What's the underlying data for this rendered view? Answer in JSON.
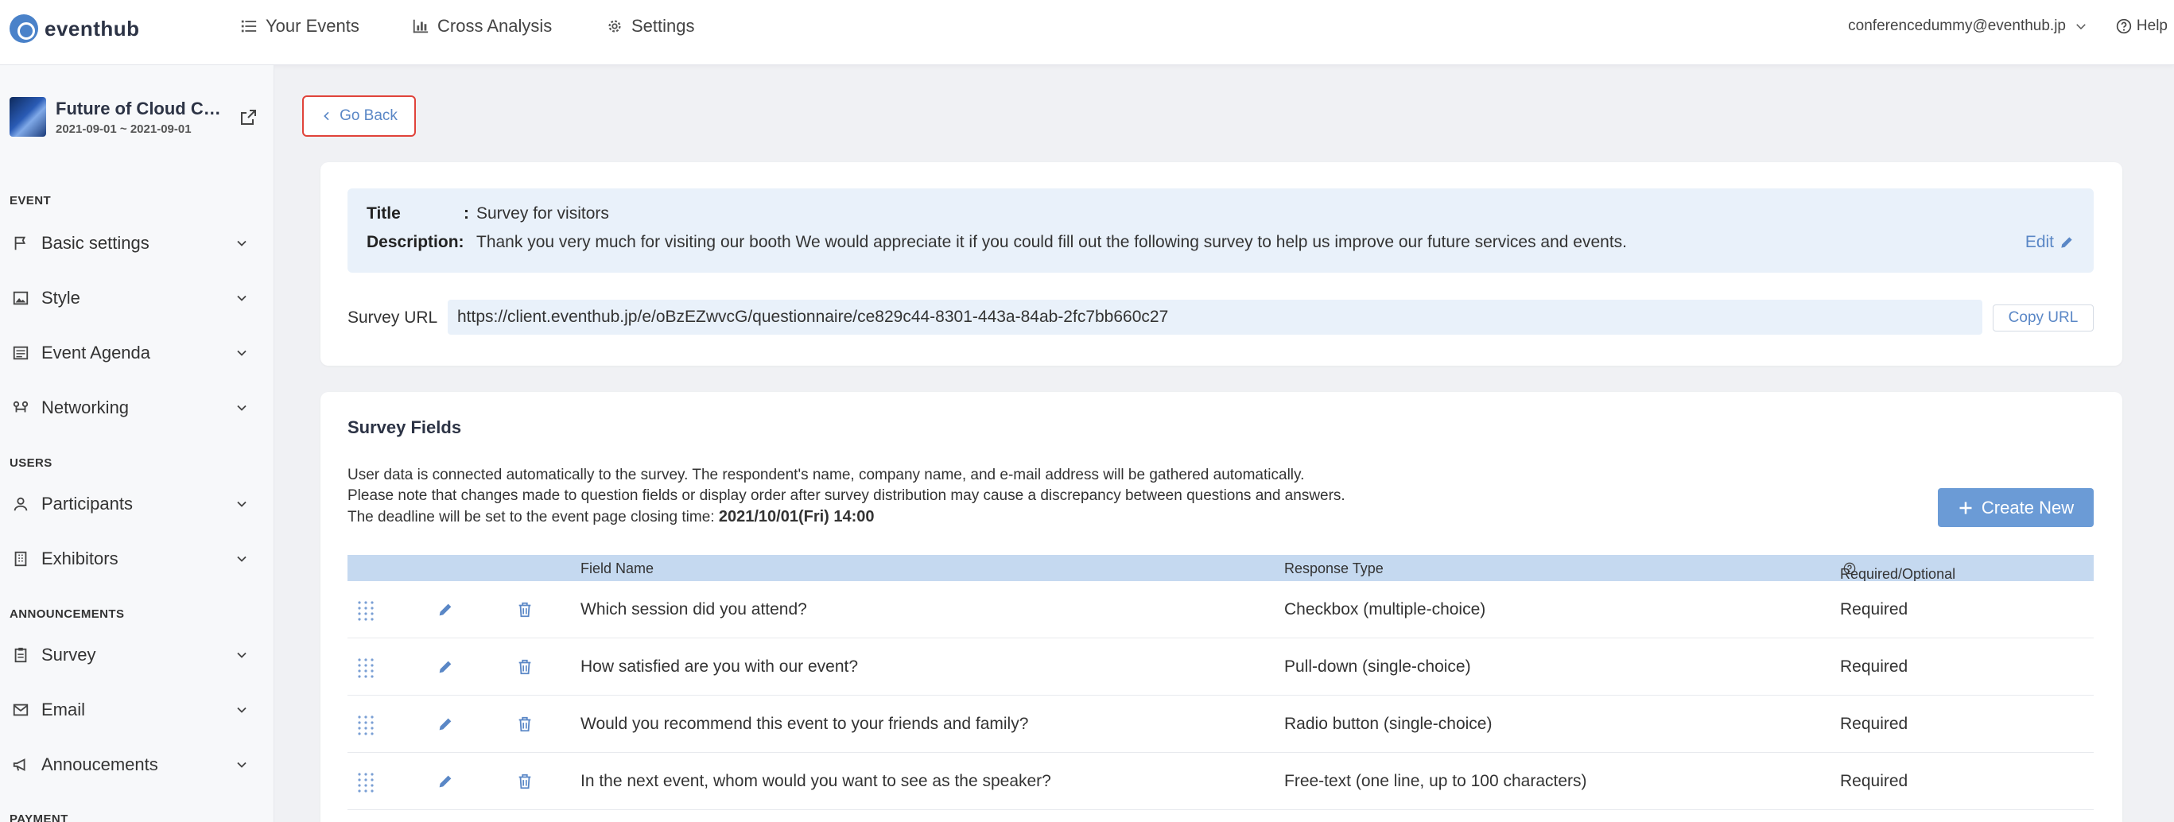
{
  "brand": {
    "name": "eventhub"
  },
  "nav": {
    "items": [
      {
        "label": "Your Events",
        "icon": "list-icon"
      },
      {
        "label": "Cross Analysis",
        "icon": "bar-chart-icon"
      },
      {
        "label": "Settings",
        "icon": "gear-icon"
      }
    ],
    "user_email": "conferencedummy@eventhub.jp",
    "help_label": "Help"
  },
  "event": {
    "title": "Future of Cloud Computing",
    "dates": "2021-09-01 ~ 2021-09-01"
  },
  "sidebar": {
    "sections": [
      {
        "label": "EVENT",
        "items": [
          "Basic settings",
          "Style",
          "Event Agenda",
          "Networking"
        ]
      },
      {
        "label": "USERS",
        "items": [
          "Participants",
          "Exhibitors"
        ]
      },
      {
        "label": "ANNOUNCEMENTS",
        "items": [
          "Survey",
          "Email",
          "Annoucements"
        ]
      },
      {
        "label": "PAYMENT",
        "items": []
      }
    ]
  },
  "go_back_label": "Go Back",
  "survey": {
    "title_label": "Title",
    "title_sep": ":",
    "title_value": "Survey for visitors",
    "description_label": "Description:",
    "description_value": "Thank you very much for visiting our booth We would appreciate it if you could fill out the following survey to help us improve our future services and events.",
    "edit_label": "Edit",
    "url_label": "Survey URL",
    "url_value": "https://client.eventhub.jp/e/oBzEZwvcG/questionnaire/ce829c44-8301-443a-84ab-2fc7bb660c27",
    "copy_label": "Copy URL"
  },
  "fields": {
    "title": "Survey Fields",
    "notice_line1": "User data is connected automatically to the survey. The respondent's name, company name, and e-mail address will be gathered automatically.",
    "notice_line2": "Please note that changes made to question fields or display order after survey distribution may cause a discrepancy between questions and answers.",
    "notice_line3": "The deadline will be set to the event page closing time: ",
    "deadline": "2021/10/01(Fri) 14:00",
    "create_label": "Create New",
    "columns": {
      "name": "Field Name",
      "type": "Response Type",
      "required": "Required/Optional"
    },
    "rows": [
      {
        "name": "Which session did you attend?",
        "type": "Checkbox (multiple-choice)",
        "required": "Required"
      },
      {
        "name": "How satisfied are you with our event?",
        "type": "Pull-down (single-choice)",
        "required": "Required"
      },
      {
        "name": "Would you recommend this event to your friends and family?",
        "type": "Radio button (single-choice)",
        "required": "Required"
      },
      {
        "name": "In the next event, whom would you want to see as the speaker?",
        "type": "Free-text (one line, up to 100 characters)",
        "required": "Required"
      }
    ]
  },
  "colors": {
    "accent": "#5a87c6",
    "header_row": "#c5d9f0",
    "info_bg": "#e9f1fa",
    "highlight": "#e0433a",
    "primary_button": "#6b9bd6"
  }
}
